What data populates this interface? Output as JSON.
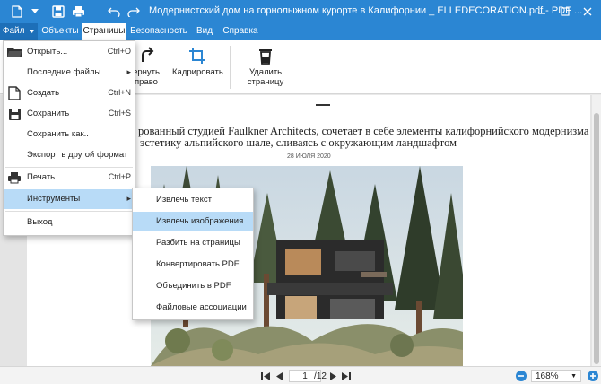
{
  "titlebar": {
    "title": "Модернистский дом на горнолыжном курорте в Калифорнии _ ELLEDECORATION.pdf - PDF ..."
  },
  "tabs": [
    {
      "label": "Файл"
    },
    {
      "label": "Объекты"
    },
    {
      "label": "Страницы"
    },
    {
      "label": "Безопасность"
    },
    {
      "label": "Вид"
    },
    {
      "label": "Справка"
    }
  ],
  "ribbon": {
    "rotate_right_label_1": "ернуть",
    "rotate_right_label_2": "право",
    "crop_label": "Кадрировать",
    "delete_label_1": "Удалить",
    "delete_label_2": "страницу"
  },
  "file_menu": {
    "items": [
      {
        "label": "Открыть...",
        "shortcut": "Ctrl+O"
      },
      {
        "label": "Последние файлы",
        "shortcut": "▸"
      },
      {
        "label": "Создать",
        "shortcut": "Ctrl+N"
      },
      {
        "label": "Сохранить",
        "shortcut": "Ctrl+S"
      },
      {
        "label": "Сохранить как..",
        "shortcut": ""
      },
      {
        "label": "Экспорт в другой формат",
        "shortcut": ""
      },
      {
        "label": "Печать",
        "shortcut": "Ctrl+P"
      },
      {
        "label": "Инструменты",
        "shortcut": "▸"
      },
      {
        "label": "Выход",
        "shortcut": ""
      }
    ]
  },
  "tools_submenu": {
    "items": [
      {
        "label": "Извлечь текст"
      },
      {
        "label": "Извлечь изображения"
      },
      {
        "label": "Разбить на страницы"
      },
      {
        "label": "Конвертировать PDF"
      },
      {
        "label": "Объединить в PDF"
      },
      {
        "label": "Файловые ассоциации"
      }
    ]
  },
  "document": {
    "line1": "рованный студией Faulkner Architects, сочетает в себе элементы калифорнийского модернизма и",
    "line2": "эстетику альпийского шале, сливаясь с окружающим ландшафтом",
    "date": "28 ИЮЛЯ 2020"
  },
  "statusbar": {
    "page_current": "1",
    "page_total": "/12",
    "zoom": "168%"
  },
  "colors": {
    "accent": "#2b86d3",
    "menu_highlight": "#b8dbf7"
  }
}
